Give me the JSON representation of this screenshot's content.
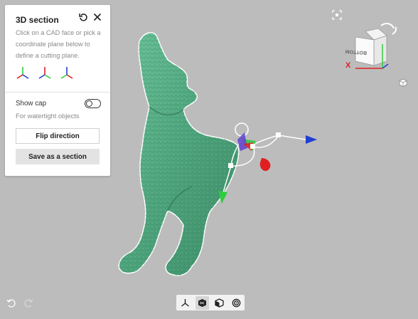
{
  "panel": {
    "title": "3D section",
    "description": "Click on a CAD face or pick a coordinate plane below to define a cutting plane.",
    "show_cap_label": "Show cap",
    "show_cap_sub": "For watertight objects",
    "show_cap_on": false,
    "flip_label": "Flip direction",
    "save_label": "Save as a section",
    "planes": [
      "plane-xy-icon",
      "plane-yz-icon",
      "plane-xz-icon"
    ]
  },
  "viewcube": {
    "face_label": "BOTTOM",
    "axis_x": "X"
  },
  "colors": {
    "model": "#52a77f",
    "x_axis": "#e02020",
    "y_axis": "#2ecc40",
    "z_axis": "#1f3fd1",
    "background": "#bcbcbc"
  },
  "toolbar": {
    "items": [
      "section-axes-icon",
      "solid-view-icon",
      "cube-face-icon",
      "spiral-icon"
    ],
    "active": 1
  }
}
